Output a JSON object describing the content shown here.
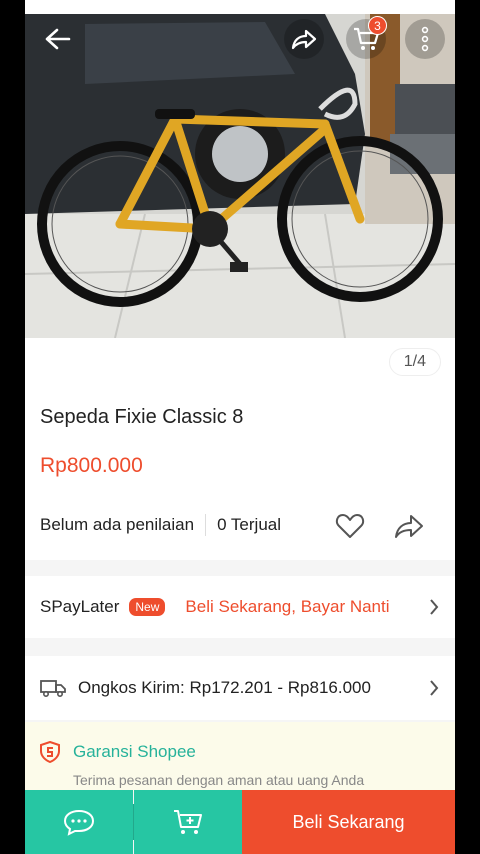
{
  "product": {
    "title": "Sepeda Fixie Classic 8",
    "price": "Rp800.000",
    "image_counter": "1/4",
    "rating_text": "Belum ada penilaian",
    "sold_text": "0 Terjual"
  },
  "header": {
    "cart_count": "3",
    "icons": [
      "back-arrow-icon",
      "share-icon",
      "cart-icon",
      "more-vert-icon"
    ]
  },
  "spaylater": {
    "label": "SPayLater",
    "badge": "New",
    "promo": "Beli Sekarang, Bayar Nanti"
  },
  "shipping": {
    "text": "Ongkos Kirim: Rp172.201 - Rp816.000"
  },
  "guarantee": {
    "title": "Garansi Shopee",
    "subtitle": "Terima pesanan dengan aman atau uang Anda"
  },
  "bottom_bar": {
    "buy_label": "Beli Sekarang"
  },
  "colors": {
    "accent": "#ee4d2d",
    "teal": "#26c6a3",
    "guarantee_text": "#26b29a"
  }
}
